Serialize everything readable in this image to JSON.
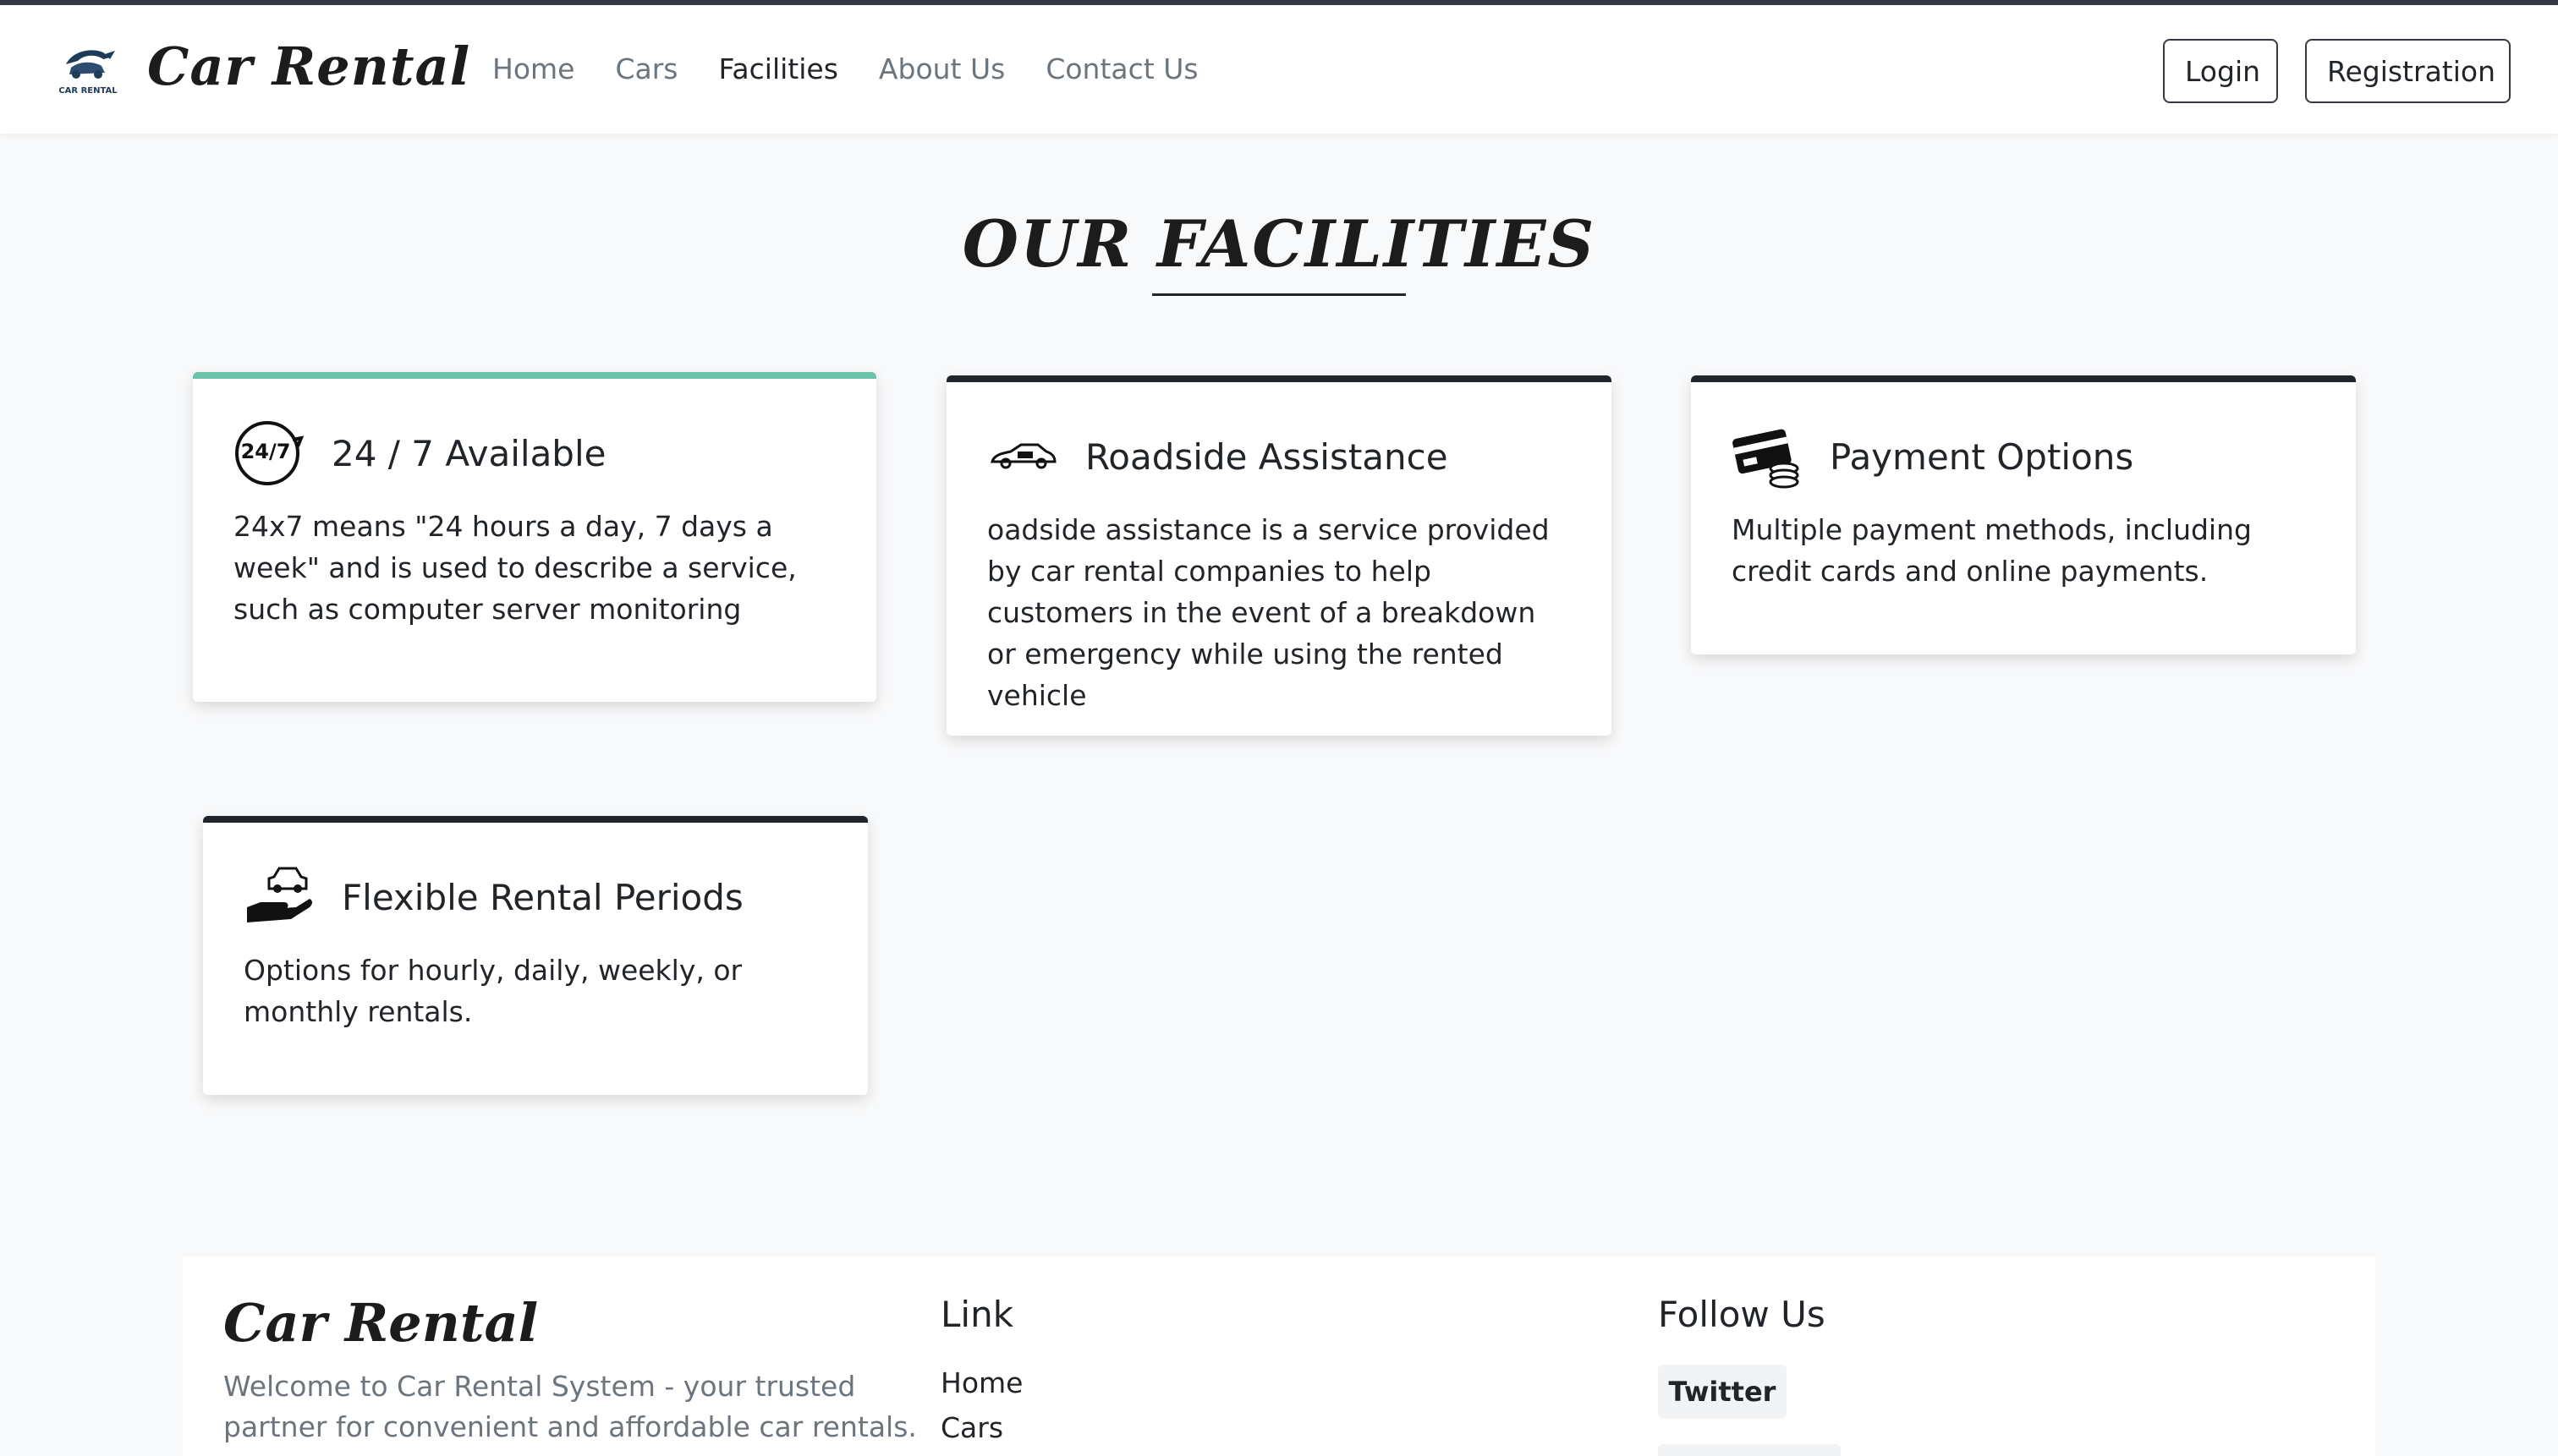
{
  "nav": {
    "brand": "Car Rental",
    "logo_text": "CAR RENTAL",
    "links": [
      {
        "label": "Home",
        "active": false
      },
      {
        "label": "Cars",
        "active": false
      },
      {
        "label": "Facilities",
        "active": true
      },
      {
        "label": "About Us",
        "active": false
      },
      {
        "label": "Contact Us",
        "active": false
      }
    ],
    "login_label": "Login",
    "register_label": "Registration"
  },
  "main": {
    "section_title": "OUR FACILITIES",
    "cards": [
      {
        "icon": "24-7-icon",
        "icon_text": "24/7",
        "title": "24 / 7 Available",
        "text": "24x7 means \"24 hours a day, 7 days a week\" and is used to describe a service, such as computer server monitoring",
        "accent": "#6cc3aa"
      },
      {
        "icon": "roadside-car-icon",
        "title": "Roadside Assistance",
        "text": "oadside assistance is a service provided by car rental companies to help customers in the event of a breakdown or emergency while using the rented vehicle",
        "accent": "#212529"
      },
      {
        "icon": "credit-card-coins-icon",
        "title": "Payment Options",
        "text": "Multiple payment methods, including credit cards and online payments.",
        "accent": "#212529"
      },
      {
        "icon": "car-in-hand-icon",
        "title": "Flexible Rental Periods",
        "text": "Options for hourly, daily, weekly, or monthly rentals.",
        "accent": "#212529"
      }
    ]
  },
  "footer": {
    "brand": "Car Rental",
    "description": "Welcome to Car Rental System - your trusted partner for convenient and affordable car rentals.",
    "link_heading": "Link",
    "links": [
      "Home",
      "Cars"
    ],
    "follow_heading": "Follow Us",
    "social": [
      "Twitter"
    ]
  }
}
